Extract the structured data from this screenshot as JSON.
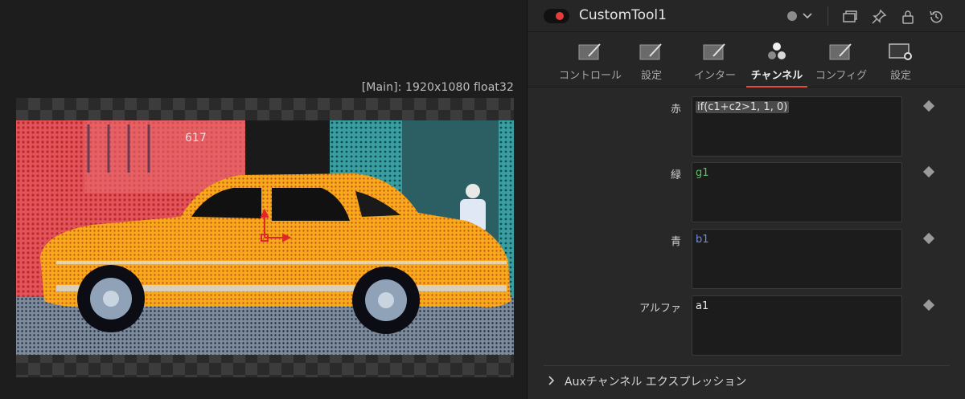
{
  "viewer": {
    "info": "[Main]: 1920x1080 float32",
    "image_text": "617"
  },
  "inspector": {
    "tool_title": "CustomTool1",
    "tabs": [
      {
        "label": "コントロール",
        "icon": "control-icon"
      },
      {
        "label": "設定",
        "icon": "settings-icon"
      },
      {
        "label": "インター",
        "icon": "interface-icon"
      },
      {
        "label": "チャンネル",
        "icon": "channels-icon",
        "active": true
      },
      {
        "label": "コンフィグ",
        "icon": "config-icon"
      },
      {
        "label": "設定",
        "icon": "gear-icon"
      }
    ],
    "channels": {
      "red": {
        "label": "赤",
        "expression": "if(c1+c2>1, 1, 0)"
      },
      "green": {
        "label": "緑",
        "expression": "g1"
      },
      "blue": {
        "label": "青",
        "expression": "b1"
      },
      "alpha": {
        "label": "アルファ",
        "expression": "a1"
      }
    },
    "aux_section": "Auxチャンネル エクスプレッション"
  },
  "colors": {
    "accent": "#e64a3c",
    "green_expr": "#5cc45c",
    "blue_expr": "#6a8ee8"
  }
}
